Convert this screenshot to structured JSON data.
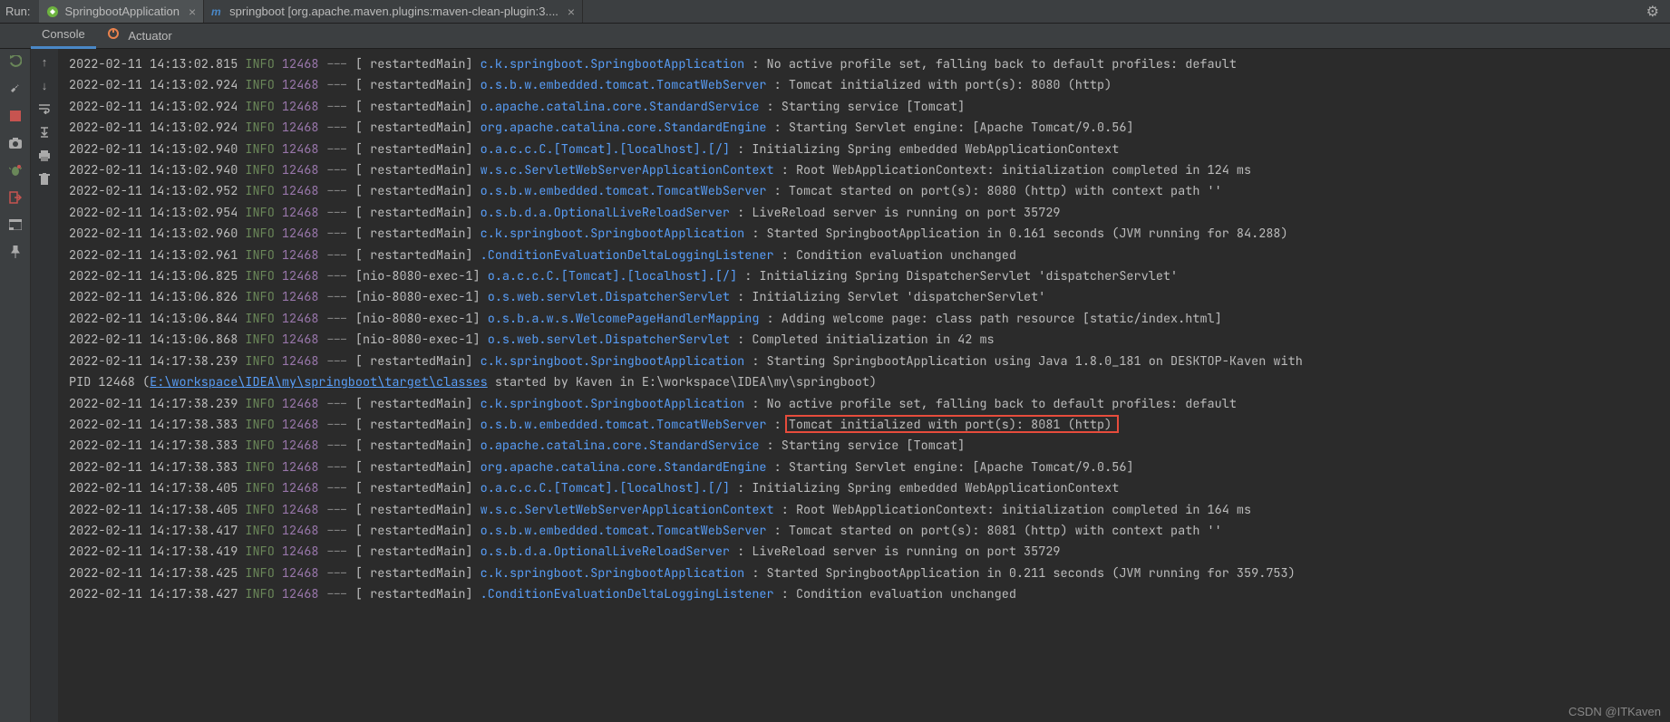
{
  "header": {
    "run_label": "Run:",
    "tabs": [
      {
        "icon": "leaf",
        "label": "SpringbootApplication",
        "closable": true,
        "active": true
      },
      {
        "icon": "maven",
        "label": "springboot [org.apache.maven.plugins:maven-clean-plugin:3....",
        "closable": true,
        "active": false
      }
    ]
  },
  "subtabs": {
    "console": "Console",
    "actuator": "Actuator"
  },
  "left_toolbar": {
    "rerun": "rerun-icon",
    "wrench": "wrench-icon",
    "stop": "stop-icon",
    "camera": "camera-icon",
    "bug": "bug-icon",
    "exit": "exit-icon",
    "layout": "layout-icon",
    "pin": "pin-icon"
  },
  "second_toolbar": {
    "up": "up-icon",
    "down": "down-icon",
    "softwrap": "softwrap-icon",
    "scroll": "scroll-icon",
    "print": "print-icon",
    "trash": "trash-icon"
  },
  "watermark": "CSDN @ITKaven",
  "log": [
    {
      "ts": "2022-02-11 14:13:02.815",
      "level": "INFO",
      "pid": "12468",
      "thread": "  restartedMain",
      "logger": "c.k.springboot.SpringbootApplication     ",
      "msg": "No active profile set, falling back to default profiles: default"
    },
    {
      "ts": "2022-02-11 14:13:02.924",
      "level": "INFO",
      "pid": "12468",
      "thread": "  restartedMain",
      "logger": "o.s.b.w.embedded.tomcat.TomcatWebServer  ",
      "msg": "Tomcat initialized with port(s): 8080 (http)"
    },
    {
      "ts": "2022-02-11 14:13:02.924",
      "level": "INFO",
      "pid": "12468",
      "thread": "  restartedMain",
      "logger": "o.apache.catalina.core.StandardService   ",
      "msg": "Starting service [Tomcat]"
    },
    {
      "ts": "2022-02-11 14:13:02.924",
      "level": "INFO",
      "pid": "12468",
      "thread": "  restartedMain",
      "logger": "org.apache.catalina.core.StandardEngine  ",
      "msg": "Starting Servlet engine: [Apache Tomcat/9.0.56]"
    },
    {
      "ts": "2022-02-11 14:13:02.940",
      "level": "INFO",
      "pid": "12468",
      "thread": "  restartedMain",
      "logger": "o.a.c.c.C.[Tomcat].[localhost].[/]       ",
      "msg": "Initializing Spring embedded WebApplicationContext"
    },
    {
      "ts": "2022-02-11 14:13:02.940",
      "level": "INFO",
      "pid": "12468",
      "thread": "  restartedMain",
      "logger": "w.s.c.ServletWebServerApplicationContext ",
      "msg": "Root WebApplicationContext: initialization completed in 124 ms"
    },
    {
      "ts": "2022-02-11 14:13:02.952",
      "level": "INFO",
      "pid": "12468",
      "thread": "  restartedMain",
      "logger": "o.s.b.w.embedded.tomcat.TomcatWebServer  ",
      "msg": "Tomcat started on port(s): 8080 (http) with context path ''"
    },
    {
      "ts": "2022-02-11 14:13:02.954",
      "level": "INFO",
      "pid": "12468",
      "thread": "  restartedMain",
      "logger": "o.s.b.d.a.OptionalLiveReloadServer       ",
      "msg": "LiveReload server is running on port 35729"
    },
    {
      "ts": "2022-02-11 14:13:02.960",
      "level": "INFO",
      "pid": "12468",
      "thread": "  restartedMain",
      "logger": "c.k.springboot.SpringbootApplication     ",
      "msg": "Started SpringbootApplication in 0.161 seconds (JVM running for 84.288)"
    },
    {
      "ts": "2022-02-11 14:13:02.961",
      "level": "INFO",
      "pid": "12468",
      "thread": "  restartedMain",
      "logger": ".ConditionEvaluationDeltaLoggingListener ",
      "msg": "Condition evaluation unchanged"
    },
    {
      "ts": "2022-02-11 14:13:06.825",
      "level": "INFO",
      "pid": "12468",
      "thread": "nio-8080-exec-1",
      "logger": "o.a.c.c.C.[Tomcat].[localhost].[/]       ",
      "msg": "Initializing Spring DispatcherServlet 'dispatcherServlet'"
    },
    {
      "ts": "2022-02-11 14:13:06.826",
      "level": "INFO",
      "pid": "12468",
      "thread": "nio-8080-exec-1",
      "logger": "o.s.web.servlet.DispatcherServlet        ",
      "msg": "Initializing Servlet 'dispatcherServlet'"
    },
    {
      "ts": "2022-02-11 14:13:06.844",
      "level": "INFO",
      "pid": "12468",
      "thread": "nio-8080-exec-1",
      "logger": "o.s.b.a.w.s.WelcomePageHandlerMapping    ",
      "msg": "Adding welcome page: class path resource [static/index.html]"
    },
    {
      "ts": "2022-02-11 14:13:06.868",
      "level": "INFO",
      "pid": "12468",
      "thread": "nio-8080-exec-1",
      "logger": "o.s.web.servlet.DispatcherServlet        ",
      "msg": "Completed initialization in 42 ms"
    },
    {
      "ts": "2022-02-11 14:17:38.239",
      "level": "INFO",
      "pid": "12468",
      "thread": "  restartedMain",
      "logger": "c.k.springboot.SpringbootApplication     ",
      "msg": "Starting SpringbootApplication using Java 1.8.0_181 on DESKTOP-Kaven with"
    },
    {
      "raw_prefix": " PID 12468 (",
      "link": "E:\\workspace\\IDEA\\my\\springboot\\target\\classes",
      "raw_suffix": " started by Kaven in E:\\workspace\\IDEA\\my\\springboot)"
    },
    {
      "ts": "2022-02-11 14:17:38.239",
      "level": "INFO",
      "pid": "12468",
      "thread": "  restartedMain",
      "logger": "c.k.springboot.SpringbootApplication     ",
      "msg": "No active profile set, falling back to default profiles: default"
    },
    {
      "ts": "2022-02-11 14:17:38.383",
      "level": "INFO",
      "pid": "12468",
      "thread": "  restartedMain",
      "logger": "o.s.b.w.embedded.tomcat.TomcatWebServer  ",
      "msg": "Tomcat initialized with port(s): 8081 (http)",
      "highlight": true
    },
    {
      "ts": "2022-02-11 14:17:38.383",
      "level": "INFO",
      "pid": "12468",
      "thread": "  restartedMain",
      "logger": "o.apache.catalina.core.StandardService   ",
      "msg": "Starting service [Tomcat]"
    },
    {
      "ts": "2022-02-11 14:17:38.383",
      "level": "INFO",
      "pid": "12468",
      "thread": "  restartedMain",
      "logger": "org.apache.catalina.core.StandardEngine  ",
      "msg": "Starting Servlet engine: [Apache Tomcat/9.0.56]"
    },
    {
      "ts": "2022-02-11 14:17:38.405",
      "level": "INFO",
      "pid": "12468",
      "thread": "  restartedMain",
      "logger": "o.a.c.c.C.[Tomcat].[localhost].[/]       ",
      "msg": "Initializing Spring embedded WebApplicationContext"
    },
    {
      "ts": "2022-02-11 14:17:38.405",
      "level": "INFO",
      "pid": "12468",
      "thread": "  restartedMain",
      "logger": "w.s.c.ServletWebServerApplicationContext ",
      "msg": "Root WebApplicationContext: initialization completed in 164 ms"
    },
    {
      "ts": "2022-02-11 14:17:38.417",
      "level": "INFO",
      "pid": "12468",
      "thread": "  restartedMain",
      "logger": "o.s.b.w.embedded.tomcat.TomcatWebServer  ",
      "msg": "Tomcat started on port(s): 8081 (http) with context path ''"
    },
    {
      "ts": "2022-02-11 14:17:38.419",
      "level": "INFO",
      "pid": "12468",
      "thread": "  restartedMain",
      "logger": "o.s.b.d.a.OptionalLiveReloadServer       ",
      "msg": "LiveReload server is running on port 35729"
    },
    {
      "ts": "2022-02-11 14:17:38.425",
      "level": "INFO",
      "pid": "12468",
      "thread": "  restartedMain",
      "logger": "c.k.springboot.SpringbootApplication     ",
      "msg": "Started SpringbootApplication in 0.211 seconds (JVM running for 359.753)"
    },
    {
      "ts": "2022-02-11 14:17:38.427",
      "level": "INFO",
      "pid": "12468",
      "thread": "  restartedMain",
      "logger": ".ConditionEvaluationDeltaLoggingListener ",
      "msg": "Condition evaluation unchanged"
    }
  ]
}
